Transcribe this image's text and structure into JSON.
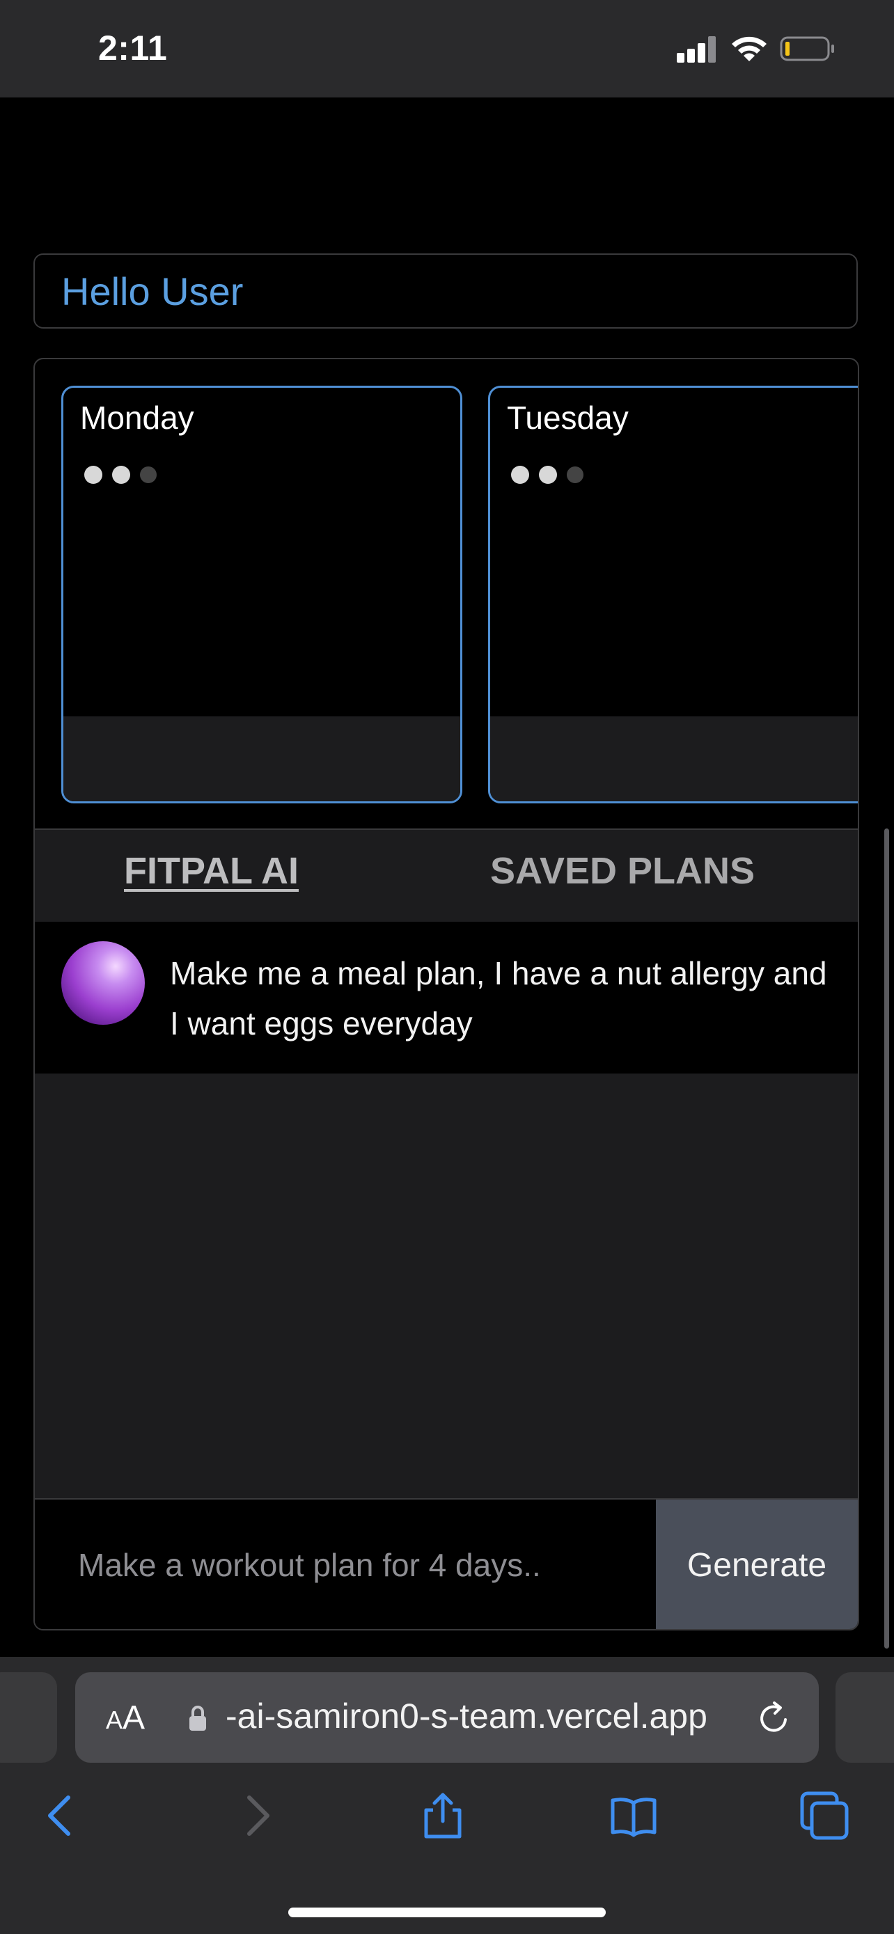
{
  "status_bar": {
    "time": "2:11"
  },
  "greeting": "Hello User",
  "days": [
    {
      "name": "Monday"
    },
    {
      "name": "Tuesday"
    }
  ],
  "tabs": {
    "active": "FITPAL AI",
    "inactive": "SAVED PLANS"
  },
  "message": {
    "text": "Make me a meal plan, I have a nut allergy and I want eggs everyday"
  },
  "input": {
    "placeholder": "Make a workout plan for 4 days..",
    "button_label": "Generate"
  },
  "browser": {
    "aa_label_small": "A",
    "aa_label_large": "A",
    "url": "-ai-samiron0-s-team.vercel.app"
  },
  "colors": {
    "accent": "#4f8fd4",
    "greeting": "#5b9fe0",
    "button": "#4a4f5a",
    "toolbar_icon": "#3f8ef0"
  }
}
